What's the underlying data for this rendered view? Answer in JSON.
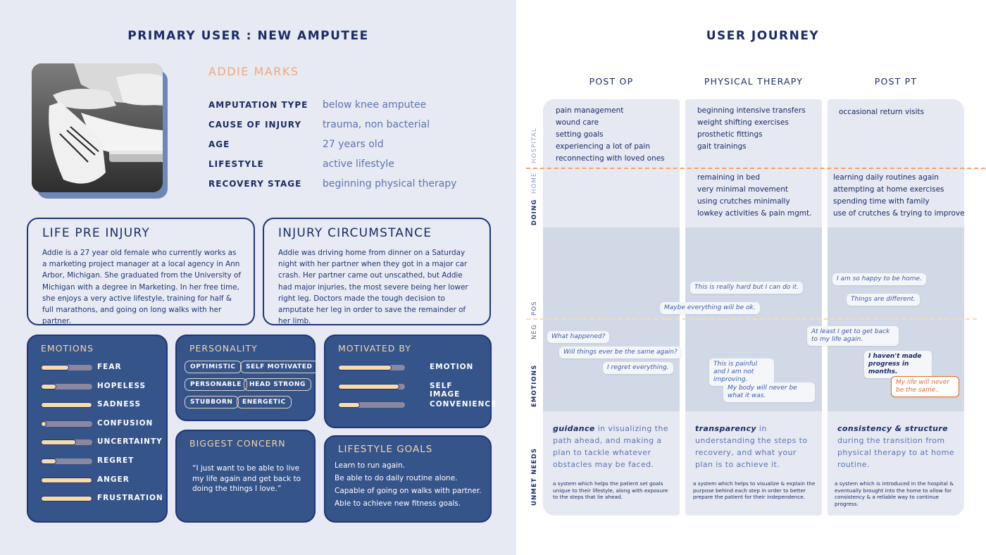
{
  "persona": {
    "title": "PRIMARY USER : NEW AMPUTEE",
    "photo": "photo-of-amputee-stretching",
    "name": "ADDIE MARKS",
    "attributes": [
      {
        "label": "AMPUTATION TYPE",
        "value": "below knee amputee"
      },
      {
        "label": "CAUSE OF INJURY",
        "value": "trauma, non bacterial"
      },
      {
        "label": "AGE",
        "value": "27 years old"
      },
      {
        "label": "LIFESTYLE",
        "value": "active lifestyle"
      },
      {
        "label": "RECOVERY STAGE",
        "value": "beginning physical therapy"
      }
    ],
    "life_pre_injury": {
      "title": "LIFE PRE INJURY",
      "text": "Addie is a 27 year old female who currently works as a marketing project manager at a local agency in Ann Arbor, Michigan. She graduated from the University of Michigan with a degree in Marketing. In her free time, she enjoys a very active lifestyle, training for half & full marathons, and going on long walks with her partner."
    },
    "injury_circumstance": {
      "title": "INJURY CIRCUMSTANCE",
      "text": "Addie was driving home from dinner on a Saturday night with her partner when they got in a major car crash. Her partner came out unscathed, but Addie had major injuries, the most severe being her lower right leg. Doctors made the tough decision to amputate her leg in order to save the remainder of her limb."
    },
    "emotions": {
      "title": "EMOTIONS",
      "items": [
        {
          "label": "FEAR",
          "level": 0.55
        },
        {
          "label": "HOPELESS",
          "level": 0.3
        },
        {
          "label": "SADNESS",
          "level": 1.0
        },
        {
          "label": "CONFUSION",
          "level": 0.08
        },
        {
          "label": "UNCERTAINTY",
          "level": 0.68
        },
        {
          "label": "REGRET",
          "level": 0.3
        },
        {
          "label": "ANGER",
          "level": 1.0
        },
        {
          "label": "FRUSTRATION",
          "level": 1.0
        }
      ]
    },
    "personality": {
      "title": "PERSONALITY",
      "traits": [
        "OPTIMISTIC",
        "SELF MOTIVATED",
        "PERSONABLE",
        "HEAD STRONG",
        "STUBBORN",
        "ENERGETIC"
      ]
    },
    "motivated_by": {
      "title": "MOTIVATED BY",
      "items": [
        {
          "label": "EMOTION",
          "level": 0.8
        },
        {
          "label": "SELF IMAGE",
          "level": 0.92
        },
        {
          "label": "CONVENIENCE",
          "level": 0.33
        }
      ]
    },
    "biggest_concern": {
      "title": "BIGGEST CONCERN",
      "quote": "“I just want to be able to live my life again and get back to doing the things I love.”"
    },
    "lifestyle_goals": {
      "title": "LIFESTYLE GOALS",
      "items": [
        "Learn to run again.",
        "Be able to do daily routine alone.",
        "Capable of going on walks with partner.",
        "Able to achieve new fitness goals."
      ]
    }
  },
  "journey": {
    "title": "USER JOURNEY",
    "lanes": {
      "hospital": "HOSPITAL",
      "home": "HOME",
      "doing": "DOING",
      "pos": "POS",
      "neg": "NEG",
      "emotions": "EMOTIONS",
      "unmet_needs": "UNMET NEEDS"
    },
    "colors": {
      "hospital_home_divider": "#f4a06e",
      "pos_neg_divider": "#f6dcaa",
      "alert": "#e66b2c"
    },
    "columns": [
      {
        "header": "POST OP",
        "hospital": "pain management\nwound care\nsetting goals\nexperiencing a lot of pain\nreconnecting with loved ones",
        "home": "",
        "bubbles": [
          "What happened?",
          "Will things ever be the same again?",
          "I regret everything."
        ],
        "need_keyword": "guidance",
        "need_text": " in visualizing the path ahead, and making a plan to tackle whatever obstacles may be faced.",
        "need_sub": "a system which helps the patient set goals unique to their lifestyle, along with exposure to the steps that lie ahead."
      },
      {
        "header": "PHYSICAL THERAPY",
        "hospital": "beginning intensive transfers\nweight shifting exercises\nprosthetic fittings\ngait trainings",
        "home": "remaining in bed\nvery minimal movement\nusing crutches minimally\nlowkey activities & pain mgmt.",
        "bubbles": [
          "This is really hard but I can do it.",
          "Maybe everything will be ok.",
          "This is painful and I am not improving.",
          "My body will never be what it was."
        ],
        "need_keyword": "transparency",
        "need_text": " in understanding the steps to recovery, and what your plan is to achieve it.",
        "need_sub": "a system which helps to visualize & explain the purpose behind each step in order to better prepare the patient for their independence."
      },
      {
        "header": "POST PT",
        "hospital": "occasional return visits",
        "home": "learning daily routines again\nattempting at home exercises\nspending time with family\nuse of crutches & trying to improve",
        "bubbles": [
          "I am so happy to be home.",
          "Things are different.",
          "At least I get to get back to my life again.",
          "I haven't made progress in months.",
          "My life will never be the same.."
        ],
        "need_keyword": "consistency & structure",
        "need_text": " during the transition from physical therapy to at home routine.",
        "need_sub": "a system which is introduced in the hospital & eventually brought into the home to allow for consistency & a reliable way to continue progress."
      }
    ]
  }
}
